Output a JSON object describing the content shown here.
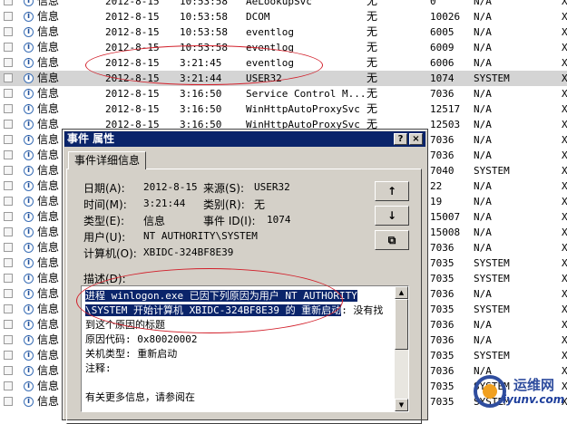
{
  "event_list": {
    "rows": [
      {
        "type": "信息",
        "date": "2012-8-15",
        "time": "10:53:58",
        "source": "AeLookupSvc",
        "category": "无",
        "id": "0",
        "user": "N/A",
        "x": "X",
        "selected": false
      },
      {
        "type": "信息",
        "date": "2012-8-15",
        "time": "10:53:58",
        "source": "DCOM",
        "category": "无",
        "id": "10026",
        "user": "N/A",
        "x": "X",
        "selected": false
      },
      {
        "type": "信息",
        "date": "2012-8-15",
        "time": "10:53:58",
        "source": "eventlog",
        "category": "无",
        "id": "6005",
        "user": "N/A",
        "x": "X",
        "selected": false
      },
      {
        "type": "信息",
        "date": "2012-8-15",
        "time": "10:53:58",
        "source": "eventlog",
        "category": "无",
        "id": "6009",
        "user": "N/A",
        "x": "X",
        "selected": false
      },
      {
        "type": "信息",
        "date": "2012-8-15",
        "time": "3:21:45",
        "source": "eventlog",
        "category": "无",
        "id": "6006",
        "user": "N/A",
        "x": "X",
        "selected": false
      },
      {
        "type": "信息",
        "date": "2012-8-15",
        "time": "3:21:44",
        "source": "USER32",
        "category": "无",
        "id": "1074",
        "user": "SYSTEM",
        "x": "X",
        "selected": true
      },
      {
        "type": "信息",
        "date": "2012-8-15",
        "time": "3:16:50",
        "source": "Service Control M...",
        "category": "无",
        "id": "7036",
        "user": "N/A",
        "x": "X",
        "selected": false
      },
      {
        "type": "信息",
        "date": "2012-8-15",
        "time": "3:16:50",
        "source": "WinHttpAutoProxySvc",
        "category": "无",
        "id": "12517",
        "user": "N/A",
        "x": "X",
        "selected": false
      },
      {
        "type": "信息",
        "date": "2012-8-15",
        "time": "3:16:50",
        "source": "WinHttpAutoProxySvc",
        "category": "无",
        "id": "12503",
        "user": "N/A",
        "x": "X",
        "selected": false
      },
      {
        "type": "信息",
        "date": "",
        "time": "",
        "source": "",
        "category": "",
        "id": "7036",
        "user": "N/A",
        "x": "X",
        "selected": false
      },
      {
        "type": "信息",
        "date": "",
        "time": "",
        "source": "",
        "category": "",
        "id": "7036",
        "user": "N/A",
        "x": "X",
        "selected": false
      },
      {
        "type": "信息",
        "date": "",
        "time": "",
        "source": "",
        "category": "",
        "id": "7040",
        "user": "SYSTEM",
        "x": "X",
        "selected": false
      },
      {
        "type": "信息",
        "date": "",
        "time": "",
        "source": "",
        "category": "",
        "id": "22",
        "user": "N/A",
        "x": "X",
        "selected": false
      },
      {
        "type": "信息",
        "date": "",
        "time": "",
        "source": "",
        "category": "",
        "id": "19",
        "user": "N/A",
        "x": "X",
        "selected": false
      },
      {
        "type": "信息",
        "date": "",
        "time": "",
        "source": "",
        "category": "",
        "id": "15007",
        "user": "N/A",
        "x": "X",
        "selected": false
      },
      {
        "type": "信息",
        "date": "",
        "time": "",
        "source": "",
        "category": "",
        "id": "15008",
        "user": "N/A",
        "x": "X",
        "selected": false
      },
      {
        "type": "信息",
        "date": "",
        "time": "",
        "source": "",
        "category": "",
        "id": "7036",
        "user": "N/A",
        "x": "X",
        "selected": false
      },
      {
        "type": "信息",
        "date": "",
        "time": "",
        "source": "",
        "category": "",
        "id": "7035",
        "user": "SYSTEM",
        "x": "X",
        "selected": false
      },
      {
        "type": "信息",
        "date": "",
        "time": "",
        "source": "",
        "category": "",
        "id": "7035",
        "user": "SYSTEM",
        "x": "X",
        "selected": false
      },
      {
        "type": "信息",
        "date": "",
        "time": "",
        "source": "",
        "category": "",
        "id": "7036",
        "user": "N/A",
        "x": "X",
        "selected": false
      },
      {
        "type": "信息",
        "date": "",
        "time": "",
        "source": "",
        "category": "",
        "id": "7035",
        "user": "SYSTEM",
        "x": "X",
        "selected": false
      },
      {
        "type": "信息",
        "date": "",
        "time": "",
        "source": "",
        "category": "",
        "id": "7036",
        "user": "N/A",
        "x": "X",
        "selected": false
      },
      {
        "type": "信息",
        "date": "",
        "time": "",
        "source": "",
        "category": "",
        "id": "7036",
        "user": "N/A",
        "x": "X",
        "selected": false
      },
      {
        "type": "信息",
        "date": "",
        "time": "",
        "source": "",
        "category": "",
        "id": "7035",
        "user": "SYSTEM",
        "x": "X",
        "selected": false
      },
      {
        "type": "信息",
        "date": "",
        "time": "",
        "source": "",
        "category": "",
        "id": "7036",
        "user": "N/A",
        "x": "X",
        "selected": false
      },
      {
        "type": "信息",
        "date": "",
        "time": "",
        "source": "",
        "category": "",
        "id": "7035",
        "user": "SYSTEM",
        "x": "X",
        "selected": false
      },
      {
        "type": "信息",
        "date": "",
        "time": "",
        "source": "",
        "category": "",
        "id": "7035",
        "user": "SYSTEM",
        "x": "X",
        "selected": false
      }
    ]
  },
  "dialog": {
    "title": "事件 属性",
    "help_label": "?",
    "close_label": "×",
    "tab_label": "事件详细信息",
    "fields": {
      "date_label": "日期(A):",
      "date_value": "2012-8-15",
      "source_label": "来源(S):",
      "source_value": "USER32",
      "time_label": "时间(M):",
      "time_value": "3:21:44",
      "category_label": "类别(R):",
      "category_value": "无",
      "type_label": "类型(E):",
      "type_value": "信息",
      "event_id_label": "事件 ID(I):",
      "event_id_value": "1074",
      "user_label": "用户(U):",
      "user_value": "NT AUTHORITY\\SYSTEM",
      "computer_label": "计算机(O):",
      "computer_value": "XBIDC-324BF8E39",
      "description_label": "描述(D):"
    },
    "nav": {
      "up_label": "↑",
      "down_label": "↓",
      "copy_label": "⧉"
    },
    "description": {
      "line1": "进程 winlogon.exe 已因下列原因为用户 NT AUTHORITY",
      "line2_hl": "\\SYSTEM 开始计算机 XBIDC-324BF8E39 的 重新启动",
      "line2_rest": ": 没有找",
      "line3": "到这个原因的标题",
      "reason_code": " 原因代码: 0x80020002",
      "shutdown_type": " 关机类型: 重新启动",
      "comment": " 注释:",
      "more_info": "有关更多信息，请参阅在"
    }
  },
  "watermark": {
    "text1": "运维网",
    "text2": "iyunv.com"
  },
  "colors": {
    "titlebar": "#0a246a",
    "dialog_bg": "#d4d0c8",
    "selection_row": "#d4d4d4",
    "annotation": "#d21f2a"
  }
}
